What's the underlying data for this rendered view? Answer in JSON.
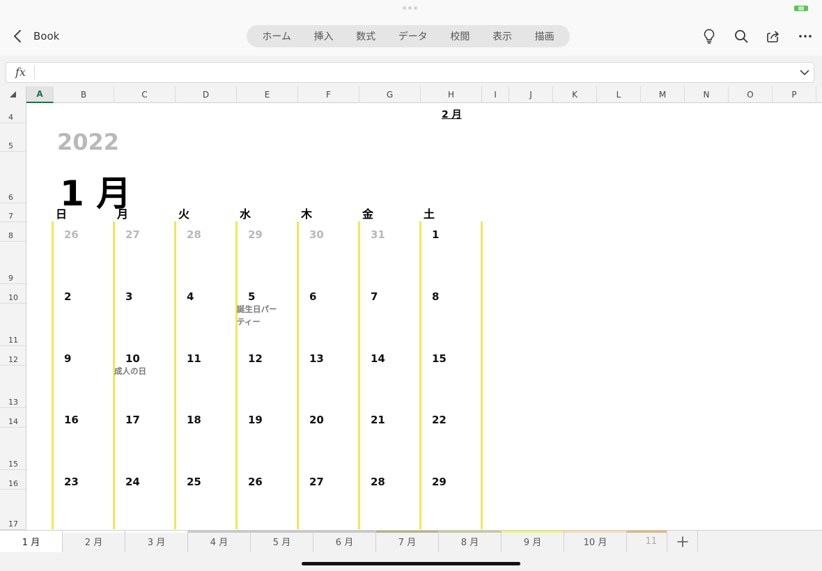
{
  "app": {
    "book_title": "Book"
  },
  "ribbon_tabs": [
    "ホーム",
    "挿入",
    "数式",
    "データ",
    "校閲",
    "表示",
    "描画"
  ],
  "toolbar_icons": [
    "lightbulb-icon",
    "search-icon",
    "share-icon",
    "more-icon"
  ],
  "formula_bar": {
    "fx_label": "fx",
    "value": ""
  },
  "columns": [
    "A",
    "B",
    "C",
    "D",
    "E",
    "F",
    "G",
    "H",
    "I",
    "J",
    "K",
    "L",
    "M",
    "N",
    "O",
    "P"
  ],
  "selected_column": "A",
  "rows": [
    "4",
    "5",
    "6",
    "7",
    "8",
    "9",
    "10",
    "11",
    "12",
    "13",
    "14",
    "15",
    "16",
    "17"
  ],
  "sheet": {
    "next_month_link": "2 月",
    "year": "2022",
    "month_title": "1 月",
    "weekdays": [
      "日",
      "月",
      "火",
      "水",
      "木",
      "金",
      "土"
    ],
    "weeks": [
      [
        "26",
        "27",
        "28",
        "29",
        "30",
        "31",
        "1"
      ],
      [
        "2",
        "3",
        "4",
        "5",
        "6",
        "7",
        "8"
      ],
      [
        "9",
        "10",
        "11",
        "12",
        "13",
        "14",
        "15"
      ],
      [
        "16",
        "17",
        "18",
        "19",
        "20",
        "21",
        "22"
      ],
      [
        "23",
        "24",
        "25",
        "26",
        "27",
        "28",
        "29"
      ]
    ],
    "other_month_days_first_week": 6,
    "events": [
      {
        "week": 1,
        "weekday": 3,
        "lines": [
          "誕生日パー",
          "ティー"
        ]
      },
      {
        "week": 2,
        "weekday": 1,
        "lines": [
          "成人の日"
        ]
      }
    ],
    "column_line_color": "#ece85c"
  },
  "sheet_tabs": [
    {
      "label": "1 月",
      "active": true
    },
    {
      "label": "2 月"
    },
    {
      "label": "3 月"
    },
    {
      "label": "4 月"
    },
    {
      "label": "5 月"
    },
    {
      "label": "6 月"
    },
    {
      "label": "7 月"
    },
    {
      "label": "8 月"
    },
    {
      "label": "9 月"
    },
    {
      "label": "10 月"
    },
    {
      "label": "11"
    }
  ],
  "colors": {
    "accent_green": "#1e7145",
    "battery": "#5cc35c"
  }
}
